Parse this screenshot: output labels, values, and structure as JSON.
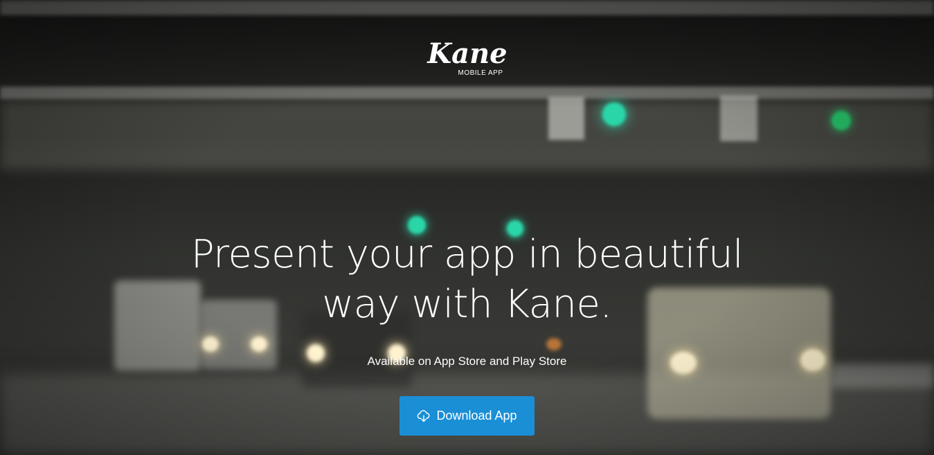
{
  "brand": {
    "name": "Kane",
    "tagline": "MOBILE APP"
  },
  "hero": {
    "headline_line1": "Present your app in beautiful",
    "headline_line2": "way with Kane.",
    "subline": "Available on App Store and Play Store"
  },
  "cta": {
    "label": "Download App",
    "icon": "cloud-download-icon"
  },
  "colors": {
    "button": "#1a8fd6",
    "text": "#ffffff"
  }
}
